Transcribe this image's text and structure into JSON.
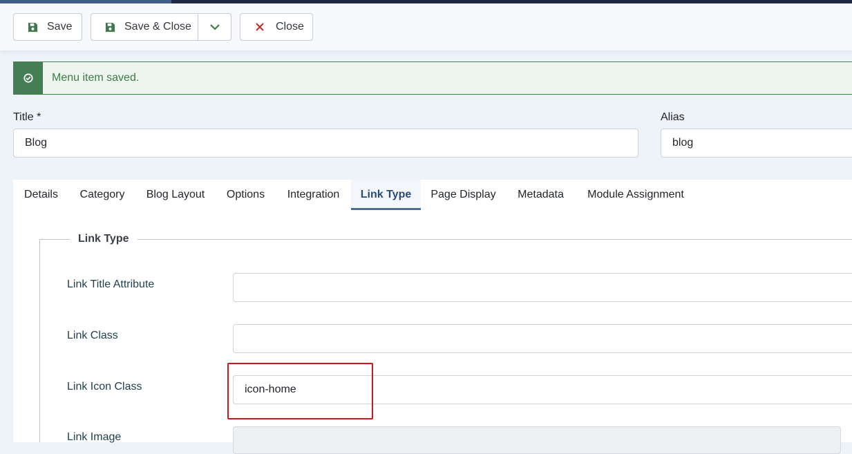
{
  "toolbar": {
    "save_label": "Save",
    "save_close_label": "Save & Close",
    "close_label": "Close"
  },
  "alert": {
    "message": "Menu item saved."
  },
  "form": {
    "title_label": "Title *",
    "title_value": "Blog",
    "alias_label": "Alias",
    "alias_value": "blog"
  },
  "tabs": [
    {
      "label": "Details"
    },
    {
      "label": "Category"
    },
    {
      "label": "Blog Layout"
    },
    {
      "label": "Options"
    },
    {
      "label": "Integration"
    },
    {
      "label": "Link Type",
      "active": true
    },
    {
      "label": "Page Display"
    },
    {
      "label": "Metadata"
    },
    {
      "label": "Module Assignment"
    }
  ],
  "link_type": {
    "legend": "Link Type",
    "link_title_attribute_label": "Link Title Attribute",
    "link_title_attribute_value": "",
    "link_class_label": "Link Class",
    "link_class_value": "",
    "link_icon_class_label": "Link Icon Class",
    "link_icon_class_value": "icon-home",
    "link_image_label": "Link Image"
  },
  "colors": {
    "success": "#457d54",
    "active_tab": "#2a4b78",
    "highlight": "#d2161c",
    "close_icon": "#c52a2a"
  }
}
